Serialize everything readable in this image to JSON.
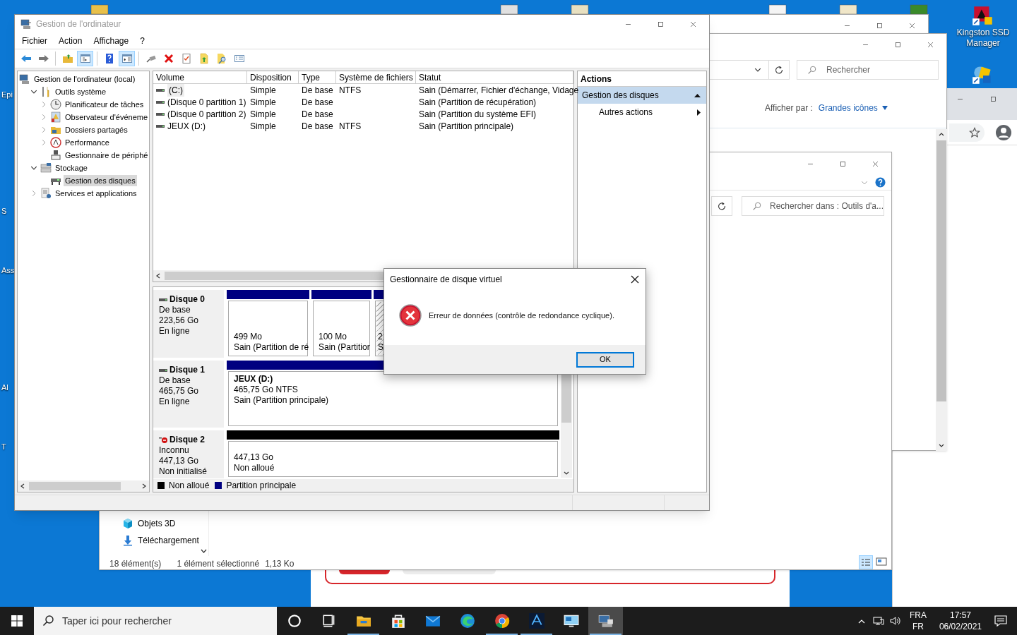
{
  "desktop": {
    "shortcuts": [
      {
        "label": "Kingston SSD Manager",
        "kind": "kingston"
      },
      {
        "kind": "app"
      }
    ],
    "edge_labels": [
      "Epi",
      "S",
      "Ass",
      "Al",
      "T"
    ]
  },
  "main_window": {
    "title": "Gestion de l'ordinateur",
    "menu": [
      "Fichier",
      "Action",
      "Affichage",
      "?"
    ],
    "toolbar": [
      {
        "kind": "back",
        "pressed": false
      },
      {
        "kind": "forward",
        "pressed": false
      },
      {
        "kind": "sep"
      },
      {
        "kind": "folder-up",
        "pressed": false
      },
      {
        "kind": "tree",
        "pressed": true
      },
      {
        "kind": "sep"
      },
      {
        "kind": "help",
        "pressed": false
      },
      {
        "kind": "pane",
        "pressed": true
      },
      {
        "kind": "sep"
      },
      {
        "kind": "connect",
        "pressed": false
      },
      {
        "kind": "delete",
        "pressed": false
      },
      {
        "kind": "properties",
        "pressed": false
      },
      {
        "kind": "export",
        "pressed": false
      },
      {
        "kind": "find",
        "pressed": false
      },
      {
        "kind": "list",
        "pressed": false
      }
    ],
    "tree": [
      {
        "label": "Gestion de l'ordinateur (local)",
        "kind": "computer",
        "selected": false,
        "children": [
          {
            "label": "Outils système",
            "kind": "tools",
            "expanded": true,
            "selected": false,
            "children": [
              {
                "label": "Planificateur de tâches",
                "kind": "clock",
                "expanded": false,
                "selected": false
              },
              {
                "label": "Observateur d'événeme",
                "kind": "eventlog",
                "expanded": false,
                "selected": false
              },
              {
                "label": "Dossiers partagés",
                "kind": "share",
                "expanded": false,
                "selected": false
              },
              {
                "label": "Performance",
                "kind": "perf",
                "expanded": false,
                "selected": false
              },
              {
                "label": "Gestionnaire de périphé",
                "kind": "device",
                "selected": false
              }
            ]
          },
          {
            "label": "Stockage",
            "kind": "storage",
            "expanded": true,
            "selected": false,
            "children": [
              {
                "label": "Gestion des disques",
                "kind": "disk",
                "selected": true
              }
            ]
          },
          {
            "label": "Services et applications",
            "kind": "services",
            "expanded": false,
            "selected": false
          }
        ]
      }
    ],
    "columns": [
      "Volume",
      "Disposition",
      "Type",
      "Système de fichiers",
      "Statut"
    ],
    "volumes": [
      {
        "volume": "(C:)",
        "layout": "Simple",
        "type": "De base",
        "filesystem": "NTFS",
        "status": "Sain (Démarrer, Fichier d'échange, Vidage"
      },
      {
        "volume": "(Disque 0 partition 1)",
        "layout": "Simple",
        "type": "De base",
        "status": "Sain (Partition de récupération)"
      },
      {
        "volume": "(Disque 0 partition 2)",
        "layout": "Simple",
        "type": "De base",
        "status": "Sain (Partition du système EFI)"
      },
      {
        "volume": "JEUX (D:)",
        "layout": "Simple",
        "type": "De base",
        "filesystem": "NTFS",
        "status": "Sain (Partition principale)"
      }
    ],
    "disks": [
      {
        "name": "Disque 0",
        "error": false,
        "lines": [
          "De base",
          "223,56 Go",
          "En ligne"
        ],
        "partitions": [
          {
            "kind": "primary",
            "lines": [
              "499 Mo",
              "Sain (Partition de ré"
            ]
          },
          {
            "kind": "primary",
            "lines": [
              "100 Mo",
              "Sain (Partitior"
            ]
          },
          {
            "kind": "primary",
            "hatched": true,
            "lines": [
              "2",
              "S"
            ]
          }
        ]
      },
      {
        "name": "Disque 1",
        "error": false,
        "lines": [
          "De base",
          "465,75 Go",
          "En ligne"
        ],
        "partitions": [
          {
            "kind": "primary",
            "title": "JEUX  (D:)",
            "lines": [
              "465,75 Go NTFS",
              "Sain (Partition principale)"
            ]
          }
        ]
      },
      {
        "name": "Disque 2",
        "error": true,
        "lines": [
          "Inconnu",
          "447,13 Go",
          "Non initialisé"
        ],
        "partitions": [
          {
            "kind": "unallocated",
            "lines": [
              "447,13 Go",
              "Non alloué"
            ]
          }
        ]
      }
    ],
    "legend": [
      {
        "label": "Non alloué",
        "color": "#000000"
      },
      {
        "label": "Partition principale",
        "color": "#000080"
      }
    ],
    "actions": {
      "header": "Actions",
      "items": [
        {
          "label": "Gestion des disques",
          "kind": "section",
          "selected": true
        },
        {
          "label": "Autres actions",
          "kind": "submenu",
          "selected": false
        }
      ]
    }
  },
  "dialog": {
    "title": "Gestionnaire de disque virtuel",
    "message": "Erreur de données (contrôle de redondance cyclique).",
    "button": "OK"
  },
  "control_panel": {
    "search_placeholder": "Rechercher",
    "view_label": "Afficher par :",
    "view_value": "Grandes icônes"
  },
  "explorer": {
    "search_placeholder": "Rechercher dans : Outils d'a...",
    "nav_items": [
      {
        "label": "Objets 3D",
        "kind": "cube"
      },
      {
        "label": "Téléchargement",
        "kind": "download"
      }
    ],
    "status": [
      "18 élément(s)",
      "1 élément sélectionné",
      "1,13 Ko"
    ]
  },
  "taskbar": {
    "search_placeholder": "Taper ici pour rechercher",
    "apps": [
      {
        "kind": "cortana",
        "running": false,
        "selected": false
      },
      {
        "kind": "taskview",
        "running": false,
        "selected": false
      },
      {
        "kind": "explorer",
        "running": true,
        "selected": false
      },
      {
        "kind": "store",
        "running": false,
        "selected": false
      },
      {
        "kind": "mail",
        "running": false,
        "selected": false
      },
      {
        "kind": "edge",
        "running": false,
        "selected": false
      },
      {
        "kind": "chrome",
        "running": true,
        "selected": false
      },
      {
        "kind": "dark-app",
        "running": true,
        "selected": false
      },
      {
        "kind": "monitor",
        "running": false,
        "selected": false
      },
      {
        "kind": "mmc",
        "running": true,
        "selected": true
      }
    ],
    "language": "FRA",
    "keyboard": "FR",
    "time": "17:57",
    "date": "06/02/2021"
  }
}
